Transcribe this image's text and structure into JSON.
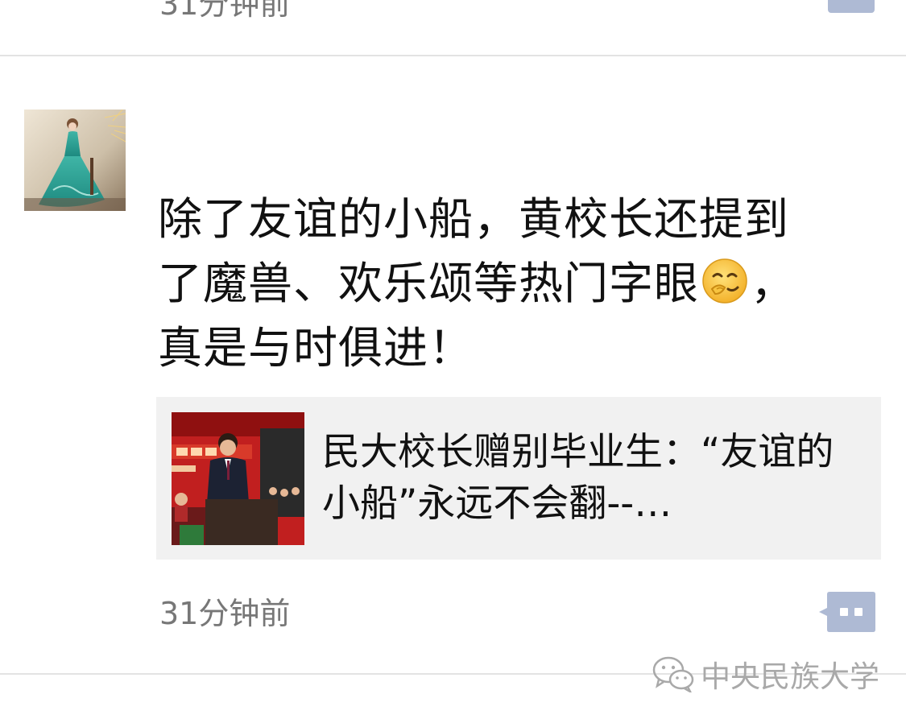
{
  "previous_post": {
    "time": "31分钟前"
  },
  "post": {
    "username": "",
    "text_line1": "除了友谊的小船，黄校长还提到",
    "text_line2_before_emoji": "了魔兽、欢乐颂等热门字眼",
    "emoji_name": "chuckle-emoji",
    "text_line2_after_emoji": "，",
    "text_line3": "真是与时俱进！",
    "link": {
      "title": "民大校长赠别毕业生：“友谊的小船”永远不会翻--…",
      "thumbnail_icon": "graduation-speech-photo"
    },
    "time": "31分钟前",
    "comment_icon": "comment-bubble-icon"
  },
  "watermark": {
    "text": "中央民族大学",
    "icon": "wechat-icon"
  },
  "colors": {
    "background": "#ffffff",
    "username": "#576b95",
    "timestamp": "#777777",
    "link_card_bg": "#f1f1f1",
    "comment_button": "#aebad4",
    "watermark": "#a9a9a9"
  }
}
